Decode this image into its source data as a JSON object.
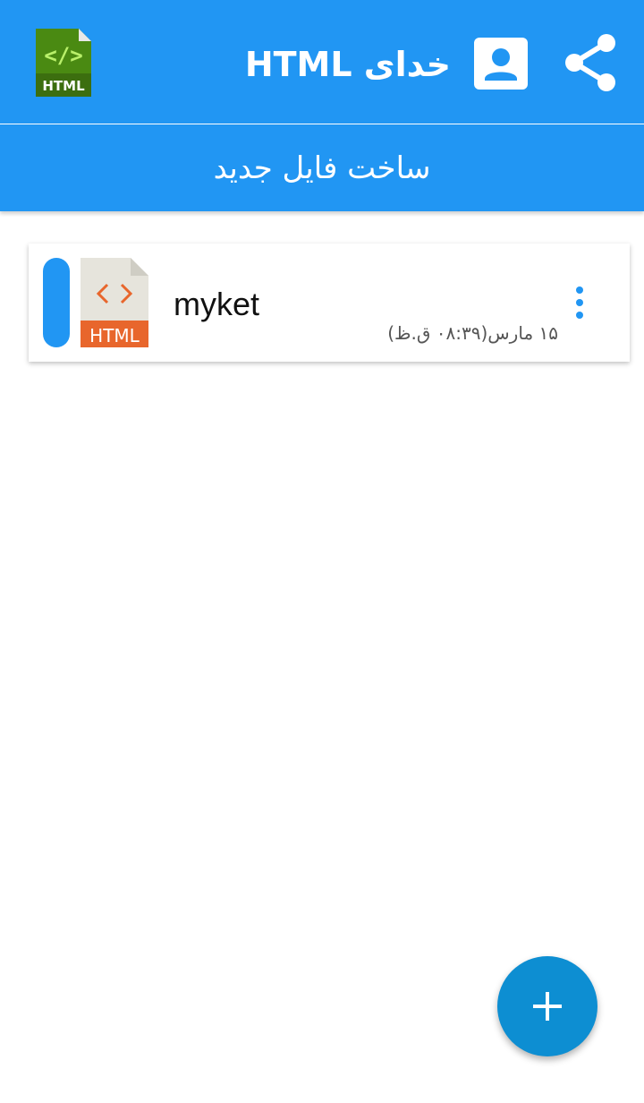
{
  "appbar": {
    "title": "خدای HTML",
    "logo_text": "HTML",
    "logo_glyph": "</>",
    "share_icon": "share-icon",
    "profile_icon": "account-box-icon",
    "color": "#2196f3"
  },
  "create_button": {
    "label": "ساخت فایل جدید"
  },
  "files": [
    {
      "name": "myket",
      "date": "۱۵ مارس(۰۸:۳۹ ق.ظ)",
      "icon_text": "HTML",
      "accent_color": "#2196f3"
    }
  ],
  "fab": {
    "icon": "plus-icon",
    "color": "#0d8ed2"
  }
}
